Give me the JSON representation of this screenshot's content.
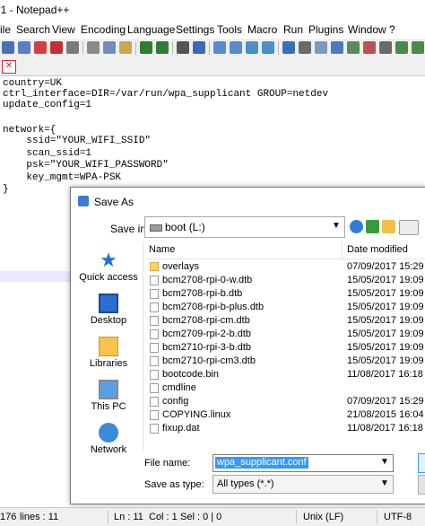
{
  "window": {
    "title": "*1 - Notepad++"
  },
  "menu": [
    "ile",
    "Search",
    "View",
    "Encoding",
    "Language",
    "Settings",
    "Tools",
    "Macro",
    "Run",
    "Plugins",
    "Window",
    "?"
  ],
  "tabs": [
    {
      "close": "✕"
    }
  ],
  "editor": {
    "lines": [
      "country=UK",
      "ctrl_interface=DIR=/var/run/wpa_supplicant GROUP=netdev",
      "update_config=1",
      "",
      "network={",
      "    ssid=\"YOUR_WIFI_SSID\"",
      "    scan_ssid=1",
      "    psk=\"YOUR_WIFI_PASSWORD\"",
      "    key_mgmt=WPA-PSK",
      "}"
    ]
  },
  "status": {
    "length": "176",
    "lines": "lines : 11",
    "ln": "Ln : 11",
    "col": "Col : 1",
    "sel": "Sel : 0 | 0",
    "eol": "Unix (LF)",
    "encoding": "UTF-8"
  },
  "dialog": {
    "title": "Save As",
    "save_in_label": "Save in:",
    "save_in_value": "boot (L:)",
    "places": [
      "Quick access",
      "Desktop",
      "Libraries",
      "This PC",
      "Network"
    ],
    "columns": {
      "name": "Name",
      "date": "Date modified"
    },
    "files": [
      {
        "name": "overlays",
        "date": "07/09/2017 15:29",
        "type": "folder"
      },
      {
        "name": "bcm2708-rpi-0-w.dtb",
        "date": "15/05/2017 19:09",
        "type": "file"
      },
      {
        "name": "bcm2708-rpi-b.dtb",
        "date": "15/05/2017 19:09",
        "type": "file"
      },
      {
        "name": "bcm2708-rpi-b-plus.dtb",
        "date": "15/05/2017 19:09",
        "type": "file"
      },
      {
        "name": "bcm2708-rpi-cm.dtb",
        "date": "15/05/2017 19:09",
        "type": "file"
      },
      {
        "name": "bcm2709-rpi-2-b.dtb",
        "date": "15/05/2017 19:09",
        "type": "file"
      },
      {
        "name": "bcm2710-rpi-3-b.dtb",
        "date": "15/05/2017 19:09",
        "type": "file"
      },
      {
        "name": "bcm2710-rpi-cm3.dtb",
        "date": "15/05/2017 19:09",
        "type": "file"
      },
      {
        "name": "bootcode.bin",
        "date": "11/08/2017 16:18",
        "type": "file"
      },
      {
        "name": "cmdline",
        "date": "",
        "type": "file"
      },
      {
        "name": "config",
        "date": "07/09/2017 15:29",
        "type": "file"
      },
      {
        "name": "COPYING.linux",
        "date": "21/08/2015 16:04",
        "type": "file"
      },
      {
        "name": "fixup.dat",
        "date": "11/08/2017 16:18",
        "type": "file"
      }
    ],
    "filename_label": "File name:",
    "filename_value": "wpa_supplicant.conf",
    "savetype_label": "Save as type:",
    "savetype_value": "All types (*.*)"
  }
}
